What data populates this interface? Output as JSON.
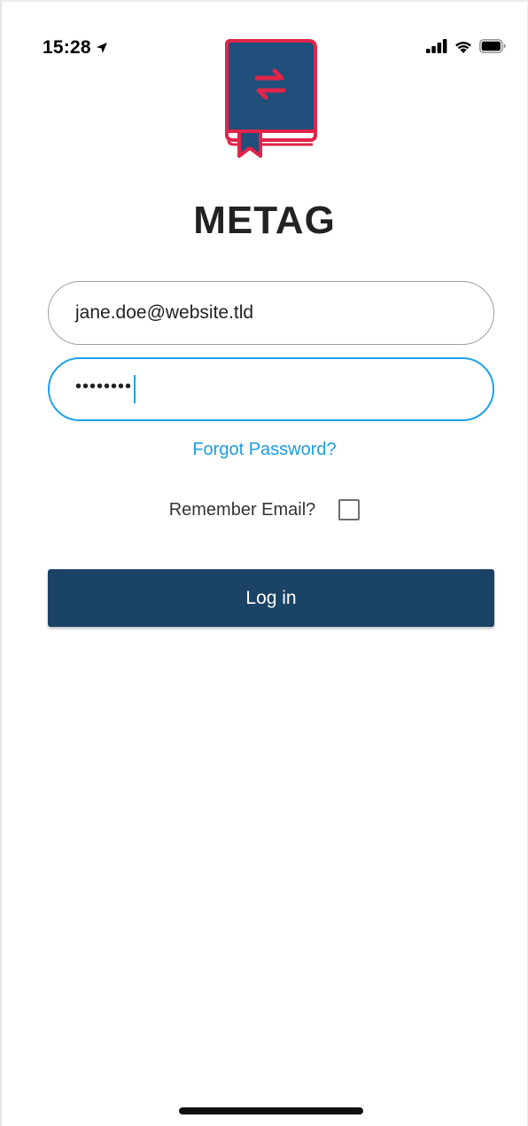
{
  "status_bar": {
    "time": "15:28",
    "icons": [
      "location-arrow-icon",
      "signal-icon",
      "wifi-icon",
      "battery-icon"
    ]
  },
  "app": {
    "title": "METAG",
    "logo_icon": "book-swap-logo",
    "colors": {
      "logo_fill": "#1f4f7a",
      "logo_accent": "#e0244a",
      "primary_button": "#1b4366",
      "link": "#1d9ce0",
      "focus_border": "#1da1e8"
    }
  },
  "login_form": {
    "email_value": "jane.doe@website.tld",
    "password_mask": "••••••••",
    "forgot_password_label": "Forgot Password?",
    "remember_email_label": "Remember Email?",
    "remember_email_checked": false,
    "login_button_label": "Log in"
  }
}
